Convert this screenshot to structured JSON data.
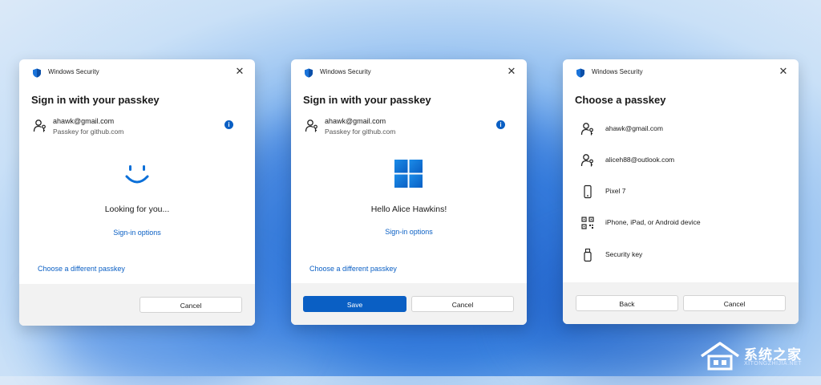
{
  "dialogs": [
    {
      "app_title": "Windows Security",
      "heading": "Sign in with your passkey",
      "account_email": "ahawk@gmail.com",
      "account_sub": "Passkey for github.com",
      "status": "Looking for you...",
      "signin_options": "Sign-in options",
      "different_passkey": "Choose a different passkey",
      "cancel": "Cancel"
    },
    {
      "app_title": "Windows Security",
      "heading": "Sign in with your passkey",
      "account_email": "ahawk@gmail.com",
      "account_sub": "Passkey for github.com",
      "status": "Hello Alice Hawkins!",
      "signin_options": "Sign-in options",
      "different_passkey": "Choose a different passkey",
      "save": "Save",
      "cancel": "Cancel"
    },
    {
      "app_title": "Windows Security",
      "heading": "Choose a passkey",
      "options": [
        {
          "label": "ahawk@gmail.com",
          "icon": "passkey-icon"
        },
        {
          "label": "aliceh88@outlook.com",
          "icon": "passkey-icon"
        },
        {
          "label": "Pixel 7",
          "icon": "phone-icon"
        },
        {
          "label": "iPhone, iPad, or Android device",
          "icon": "qr-code-icon"
        },
        {
          "label": "Security key",
          "icon": "usb-key-icon"
        }
      ],
      "back": "Back",
      "cancel": "Cancel"
    }
  ],
  "watermark": {
    "text": "系统之家",
    "sub": "XITONGZHIJIA.NET"
  },
  "colors": {
    "accent": "#0a5fc4",
    "footer": "#f2f2f2"
  }
}
